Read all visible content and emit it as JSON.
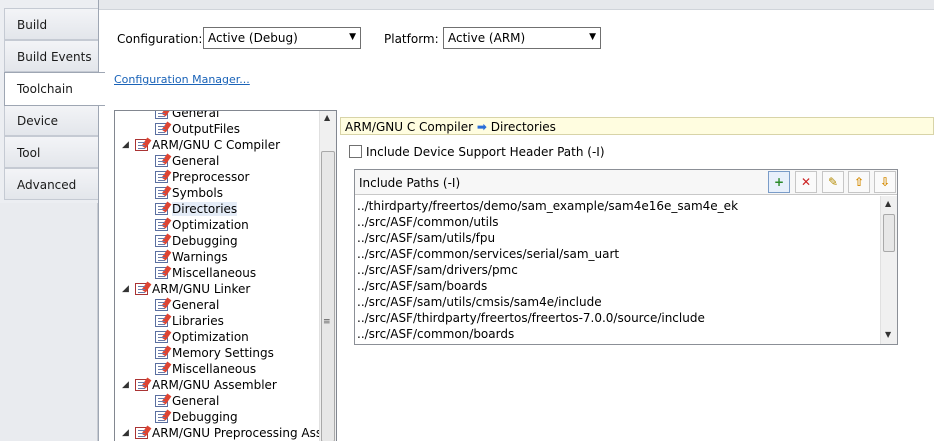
{
  "tabs": [
    {
      "label": "Build"
    },
    {
      "label": "Build Events"
    },
    {
      "label": "Toolchain"
    },
    {
      "label": "Device"
    },
    {
      "label": "Tool"
    },
    {
      "label": "Advanced"
    }
  ],
  "config": {
    "configuration_label": "Configuration:",
    "configuration_value": "Active (Debug)",
    "platform_label": "Platform:",
    "platform_value": "Active (ARM)",
    "manager_link": "Configuration Manager..."
  },
  "tree": {
    "nodes": [
      {
        "label": "General"
      },
      {
        "label": "OutputFiles"
      },
      {
        "label": "ARM/GNU C Compiler"
      },
      {
        "label": "General"
      },
      {
        "label": "Preprocessor"
      },
      {
        "label": "Symbols"
      },
      {
        "label": "Directories"
      },
      {
        "label": "Optimization"
      },
      {
        "label": "Debugging"
      },
      {
        "label": "Warnings"
      },
      {
        "label": "Miscellaneous"
      },
      {
        "label": "ARM/GNU Linker"
      },
      {
        "label": "General"
      },
      {
        "label": "Libraries"
      },
      {
        "label": "Optimization"
      },
      {
        "label": "Memory Settings"
      },
      {
        "label": "Miscellaneous"
      },
      {
        "label": "ARM/GNU Assembler"
      },
      {
        "label": "General"
      },
      {
        "label": "Debugging"
      },
      {
        "label": "ARM/GNU Preprocessing Assembler"
      }
    ],
    "selected": "Directories"
  },
  "breadcrumb": {
    "part1": "ARM/GNU C Compiler",
    "arrow": "➡",
    "part2": "Directories"
  },
  "include_device": {
    "label": "Include Device Support Header Path (-I)",
    "checked": false
  },
  "include_paths": {
    "header": "Include Paths (-I)",
    "toolbar_icons": [
      "add-item-icon",
      "delete-item-icon",
      "edit-item-icon",
      "move-up-icon",
      "move-down-icon"
    ],
    "items": [
      "../thirdparty/freertos/demo/sam_example/sam4e16e_sam4e_ek",
      "../src/ASF/common/utils",
      "../src/ASF/sam/utils/fpu",
      "../src/ASF/common/services/serial/sam_uart",
      "../src/ASF/sam/drivers/pmc",
      "../src/ASF/sam/boards",
      "../src/ASF/sam/utils/cmsis/sam4e/include",
      "../src/ASF/thirdparty/freertos/freertos-7.0.0/source/include",
      "../src/ASF/common/boards"
    ]
  }
}
